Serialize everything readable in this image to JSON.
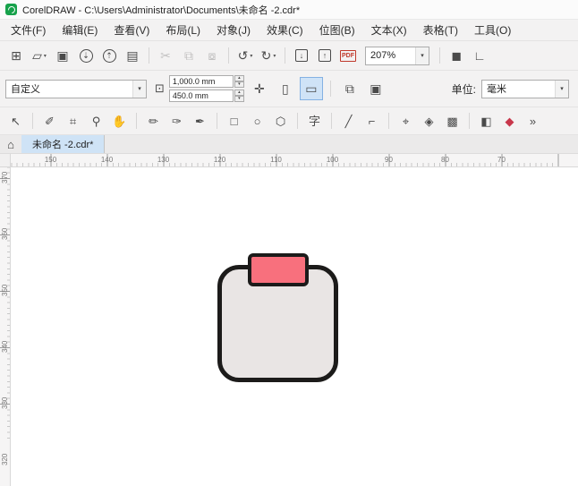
{
  "window": {
    "title": "CorelDRAW - C:\\Users\\Administrator\\Documents\\未命名 -2.cdr*"
  },
  "colors": {
    "logo_green": "#17a24b",
    "active_tab_bg": "#cfe3f6"
  },
  "menu": {
    "items": [
      "文件(F)",
      "编辑(E)",
      "查看(V)",
      "布局(L)",
      "对象(J)",
      "效果(C)",
      "位图(B)",
      "文本(X)",
      "表格(T)",
      "工具(O)"
    ]
  },
  "toolbar": {
    "caret": "▾",
    "zoom_value": "207%",
    "items": [
      {
        "name": "new-document",
        "glyph": "⊞"
      },
      {
        "name": "open",
        "glyph": "▱",
        "caret": true
      },
      {
        "name": "save",
        "glyph": "▣"
      },
      {
        "name": "open-from-cloud",
        "glyph": "⇣",
        "cls": "circ"
      },
      {
        "name": "save-to-cloud",
        "glyph": "⇡",
        "cls": "circ"
      },
      {
        "name": "print",
        "glyph": "▤"
      },
      {
        "sep": true
      },
      {
        "name": "cut",
        "glyph": "✂",
        "disabled": true
      },
      {
        "name": "copy",
        "glyph": "⧉",
        "disabled": true
      },
      {
        "name": "paste",
        "glyph": "⧇",
        "disabled": true
      },
      {
        "sep": true
      },
      {
        "name": "undo",
        "glyph": "↺",
        "caret": true
      },
      {
        "name": "redo",
        "glyph": "↻",
        "caret": true
      },
      {
        "sep": true
      },
      {
        "name": "import",
        "glyph": "↓",
        "cls": "boxed"
      },
      {
        "name": "export",
        "glyph": "↑",
        "cls": "boxed"
      },
      {
        "name": "publish-pdf",
        "glyph": "PDF",
        "cls": "pdf"
      }
    ],
    "items_right": [
      {
        "sep": true
      },
      {
        "name": "full-screen-preview",
        "glyph": "◼"
      },
      {
        "name": "show-rulers",
        "glyph": "∟"
      }
    ]
  },
  "property_bar": {
    "preset_value": "自定义",
    "page_width": "1,000.0 mm",
    "page_height": "450.0 mm",
    "units_label": "单位:",
    "units_value": "毫米",
    "icons": {
      "page_dimensions": "⊡",
      "up": "▴",
      "down": "▾",
      "nudge": "✛",
      "portrait": "▯",
      "landscape": "▭",
      "apply_all_pages": "⧉",
      "apply_current_page": "▣"
    }
  },
  "toolbox": {
    "tools": [
      {
        "name": "pick-tool",
        "glyph": "↖"
      },
      {
        "sep": true
      },
      {
        "name": "shape-tool",
        "glyph": "✐"
      },
      {
        "name": "crop-tool",
        "glyph": "⌗"
      },
      {
        "name": "zoom-tool",
        "glyph": "⚲"
      },
      {
        "name": "pan-tool",
        "glyph": "✋"
      },
      {
        "sep": true
      },
      {
        "name": "freehand-tool",
        "glyph": "✏"
      },
      {
        "name": "artistic-media-tool",
        "glyph": "✑"
      },
      {
        "name": "pen-tool",
        "glyph": "✒"
      },
      {
        "sep": true
      },
      {
        "name": "rectangle-tool",
        "glyph": "□"
      },
      {
        "name": "ellipse-tool",
        "glyph": "○"
      },
      {
        "name": "polygon-tool",
        "glyph": "⬡"
      },
      {
        "sep": true
      },
      {
        "name": "text-tool",
        "glyph": "字"
      },
      {
        "sep": true
      },
      {
        "name": "dimension-tool",
        "glyph": "╱"
      },
      {
        "name": "connector-tool",
        "glyph": "⌐"
      },
      {
        "sep": true
      },
      {
        "name": "color-eyedropper-tool",
        "glyph": "⌖"
      },
      {
        "name": "outline-pen-tool",
        "glyph": "◈"
      },
      {
        "name": "fill-tool",
        "glyph": "▩"
      },
      {
        "sep": true
      },
      {
        "name": "interactive-fill-tool",
        "glyph": "◧"
      },
      {
        "name": "smart-fill-tool",
        "glyph": "◆",
        "color": "#c8374b"
      },
      {
        "name": "more-tools",
        "glyph": "»"
      }
    ]
  },
  "tabs": {
    "home_icon": "⌂",
    "active_label": "未命名 -2.cdr*"
  },
  "rulers": {
    "horizontal": [
      "150",
      "140",
      "130",
      "120",
      "110",
      "100",
      "90",
      "80",
      "70"
    ],
    "vertical": [
      "370",
      "360",
      "350",
      "340",
      "330",
      "320"
    ]
  },
  "canvas": {
    "square": {
      "fill": "#e9e5e4",
      "stroke": "#1c1b1a"
    },
    "red_tab": {
      "fill": "#f8707d",
      "stroke": "#1c1b1a"
    }
  }
}
